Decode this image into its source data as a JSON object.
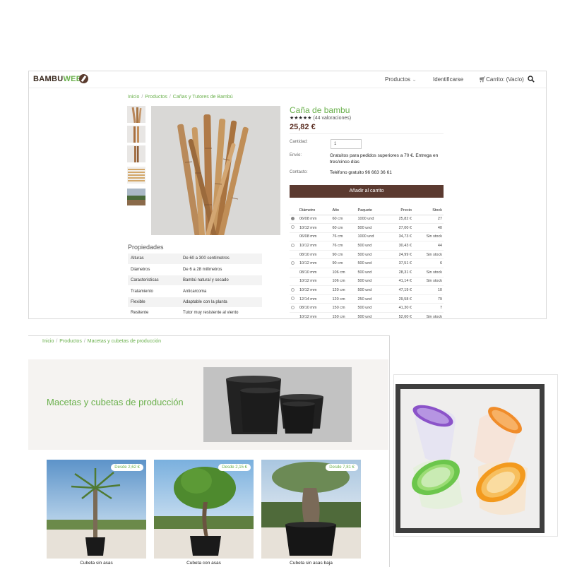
{
  "product_page": {
    "brand": {
      "part1": "BAMBU",
      "part2": "WEB"
    },
    "nav": {
      "products": "Productos",
      "login": "Identificarse",
      "cart": "Carrito: (Vacío)"
    },
    "breadcrumb": [
      "Inicio",
      "Productos",
      "Cañas y Tutores de Bambú"
    ],
    "title": "Caña de bambu",
    "stars": "★★★★★",
    "ratings": "(44 valoraciones)",
    "price": "25,82 €",
    "quantity": {
      "label": "Cantidad:",
      "value": "1"
    },
    "shipping": {
      "label": "Envío:",
      "value": "Gratuitos para pedidos superiores a 70 €. Entrega en tres/cinco días"
    },
    "contact": {
      "label": "Contacto:",
      "value": "Teléfono gratuito 96 663 36 61"
    },
    "add_to_cart": "Añadir al carrito",
    "table_headers": [
      "Diámetro",
      "Alto",
      "Paquete",
      "Precio",
      "Stock"
    ],
    "rows": [
      {
        "radio": true,
        "selected": true,
        "diam": "06/08 mm",
        "alto": "60 cm",
        "paquete": "1000 und",
        "precio": "25,82 €",
        "stock": "27"
      },
      {
        "radio": true,
        "selected": false,
        "diam": "10/12 mm",
        "alto": "60 cm",
        "paquete": "500 und",
        "precio": "27,00 €",
        "stock": "40"
      },
      {
        "radio": false,
        "selected": false,
        "diam": "06/08 mm",
        "alto": "76 cm",
        "paquete": "1000 und",
        "precio": "34,73 €",
        "stock": "Sin stock"
      },
      {
        "radio": true,
        "selected": false,
        "diam": "10/12 mm",
        "alto": "76 cm",
        "paquete": "500 und",
        "precio": "30,43 €",
        "stock": "44"
      },
      {
        "radio": false,
        "selected": false,
        "diam": "08/10 mm",
        "alto": "90 cm",
        "paquete": "500 und",
        "precio": "24,99 €",
        "stock": "Sin stock"
      },
      {
        "radio": true,
        "selected": false,
        "diam": "10/12 mm",
        "alto": "90 cm",
        "paquete": "500 und",
        "precio": "37,51 €",
        "stock": "6"
      },
      {
        "radio": false,
        "selected": false,
        "diam": "08/10 mm",
        "alto": "106 cm",
        "paquete": "500 und",
        "precio": "28,31 €",
        "stock": "Sin stock"
      },
      {
        "radio": false,
        "selected": false,
        "diam": "10/12 mm",
        "alto": "106 cm",
        "paquete": "500 und",
        "precio": "41,14 €",
        "stock": "Sin stock"
      },
      {
        "radio": true,
        "selected": false,
        "diam": "10/12 mm",
        "alto": "120 cm",
        "paquete": "500 und",
        "precio": "47,19 €",
        "stock": "10"
      },
      {
        "radio": true,
        "selected": false,
        "diam": "12/14 mm",
        "alto": "120 cm",
        "paquete": "250 und",
        "precio": "29,58 €",
        "stock": "79"
      },
      {
        "radio": true,
        "selected": false,
        "diam": "08/10 mm",
        "alto": "150 cm",
        "paquete": "500 und",
        "precio": "41,30 €",
        "stock": "7"
      },
      {
        "radio": false,
        "selected": false,
        "diam": "10/12 mm",
        "alto": "150 cm",
        "paquete": "500 und",
        "precio": "52,60 €",
        "stock": "Sin stock"
      }
    ],
    "properties_title": "Propiedades",
    "properties": [
      {
        "k": "Alturas",
        "v": "De 60 a 300 centímetros"
      },
      {
        "k": "Diámetros",
        "v": "De 6 a 28 milímetros"
      },
      {
        "k": "Caracteristicas",
        "v": "Bambú natural y secado"
      },
      {
        "k": "Tratamiento",
        "v": "Anticarcoma"
      },
      {
        "k": "Flexible",
        "v": "Adaptable con la planta"
      },
      {
        "k": "Resitente",
        "v": "Tutor muy resistente al viento"
      }
    ]
  },
  "category_page": {
    "breadcrumb": [
      "Inicio",
      "Productos",
      "Macetas y cubetas de producción"
    ],
    "title": "Macetas y cubetas de producción",
    "products": [
      {
        "name": "Cubeta sin asas",
        "price": "Desde 2,62 €"
      },
      {
        "name": "Cubeta con asas",
        "price": "Desde 2,15 €"
      },
      {
        "name": "Cubeta sin asas baja",
        "price": "Desde 7,81 €"
      }
    ]
  },
  "colors": {
    "green": "#6ab04c",
    "brown": "#5b3a30",
    "price": "#5b2e22"
  }
}
